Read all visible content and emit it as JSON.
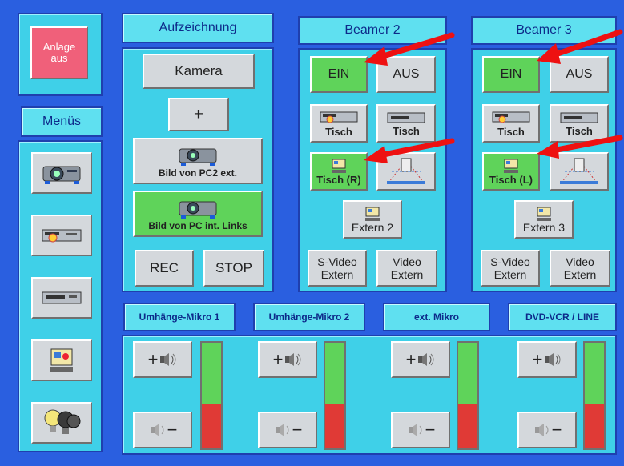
{
  "left": {
    "anlage_label": "Anlage aus",
    "menus_title": "Menüs",
    "menu_items": [
      "beamer-icon",
      "vcr-dvd-icon",
      "vcr-icon",
      "pc-monitor-icon",
      "light-bulbs-icon"
    ]
  },
  "aufzeichnung": {
    "title": "Aufzeichnung",
    "kamera": "Kamera",
    "plus": "+",
    "bild_pc2": "Bild von PC2 ext.",
    "bild_pc_links": "Bild von PC int. Links",
    "rec": "REC",
    "stop": "STOP"
  },
  "beamer2": {
    "title": "Beamer 2",
    "ein": "EIN",
    "aus": "AUS",
    "tisch1": "Tisch",
    "tisch2": "Tisch",
    "tisch_r": "Tisch (R)",
    "extern": "Extern 2",
    "svideo": "S-Video Extern",
    "video": "Video Extern"
  },
  "beamer3": {
    "title": "Beamer 3",
    "ein": "EIN",
    "aus": "AUS",
    "tisch1": "Tisch",
    "tisch2": "Tisch",
    "tisch_l": "Tisch (L)",
    "extern": "Extern 3",
    "svideo": "S-Video Extern",
    "video": "Video Extern"
  },
  "audio": {
    "channels": [
      {
        "name": "Umhänge-Mikro 1",
        "up": "+",
        "down": "−",
        "level": 0.42
      },
      {
        "name": "Umhänge-Mikro 2",
        "up": "+",
        "down": "−",
        "level": 0.42
      },
      {
        "name": "ext. Mikro",
        "up": "+",
        "down": "−",
        "level": 0.42
      },
      {
        "name": "DVD-VCR / LINE",
        "up": "+",
        "down": "−",
        "level": 0.42
      }
    ]
  },
  "colors": {
    "background": "#2a5fe0",
    "panel": "#3fd0e8",
    "active_green": "#5fd35a",
    "alarm_red": "#f0607a",
    "arrow_red": "#ee1111"
  }
}
